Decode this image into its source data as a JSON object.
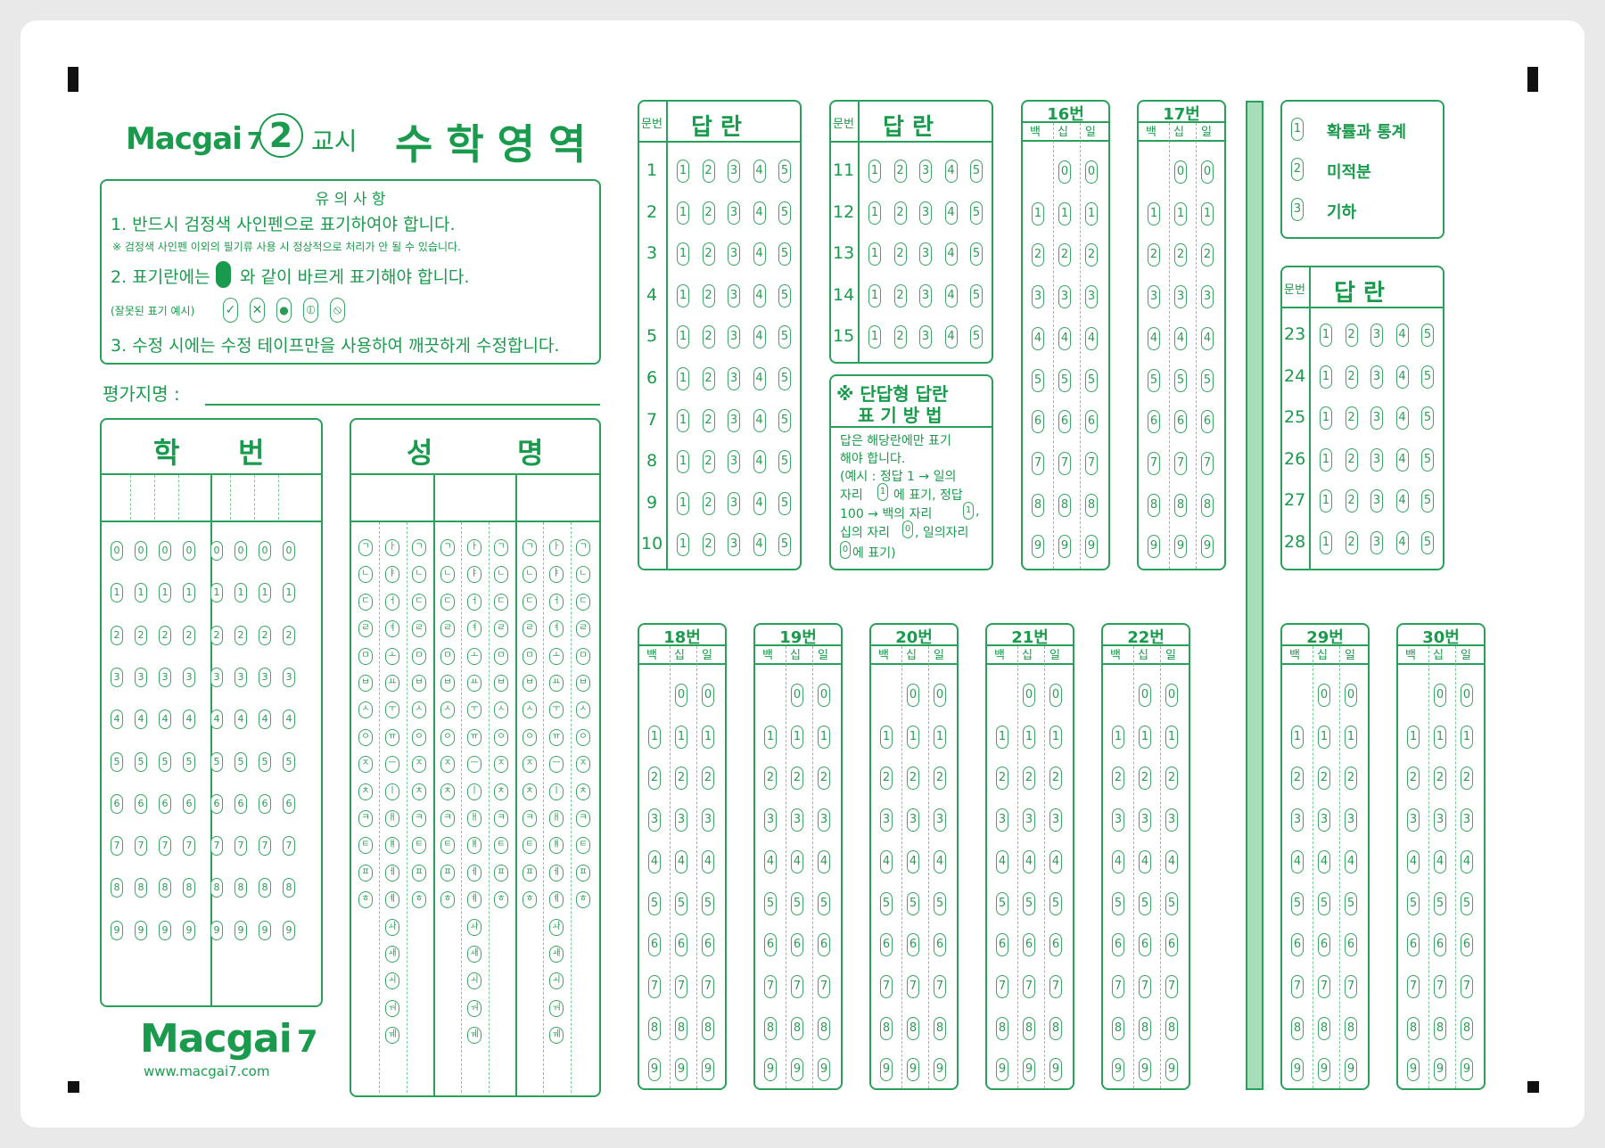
{
  "brand": {
    "logo": "Macgai",
    "logo_num": "7",
    "url": "www.macgai7.com"
  },
  "header": {
    "period_num": "2",
    "period_label": "교시",
    "subject": "수학영역"
  },
  "notice": {
    "title": "유 의 사 항",
    "line1": "1. 반드시 검정색 사인펜으로 표기하여야 합니다.",
    "line1_note": "※ 검정색 사인펜 이외의 필기류 사용 시 정상적으로 처리가 안 될 수 있습니다.",
    "line2_pre": "2. 표기란에는",
    "line2_post": "와 같이 바르게 표기해야 합니다.",
    "wrong_label": "(잘못된 표기 예시)",
    "wrong_marks": [
      "✓",
      "✕",
      "●",
      "⦶",
      "⦸"
    ],
    "line3": "3. 수정 시에는 수정 테이프만을 사용하여 깨끗하게 수정합니다."
  },
  "evaluator": {
    "label": "평가지명 :"
  },
  "student_id": {
    "title_a": "학",
    "title_b": "번",
    "digits": [
      "0",
      "1",
      "2",
      "3",
      "4",
      "5",
      "6",
      "7",
      "8",
      "9"
    ]
  },
  "name": {
    "title_a": "성",
    "title_b": "명",
    "consonants": [
      "ㄱ",
      "ㄴ",
      "ㄷ",
      "ㄹ",
      "ㅁ",
      "ㅂ",
      "ㅅ",
      "ㅇ",
      "ㅈ",
      "ㅊ",
      "ㅋ",
      "ㅌ",
      "ㅍ",
      "ㅎ"
    ],
    "vowels": [
      "ㅏ",
      "ㅑ",
      "ㅓ",
      "ㅕ",
      "ㅗ",
      "ㅛ",
      "ㅜ",
      "ㅠ",
      "ㅡ",
      "ㅣ",
      "ㅐ",
      "ㅒ",
      "ㅔ",
      "ㅖ",
      "ㅘ",
      "ㅙ",
      "ㅚ",
      "ㅝ",
      "ㅞ"
    ],
    "finals": [
      "ㄱ",
      "ㄴ",
      "ㄷ",
      "ㄹ",
      "ㅁ",
      "ㅂ",
      "ㅅ",
      "ㅇ",
      "ㅈ",
      "ㅊ",
      "ㅋ",
      "ㅌ",
      "ㅍ",
      "ㅎ"
    ]
  },
  "mc": {
    "head_num": "문번",
    "head_ans": "답   란",
    "choices": [
      "1",
      "2",
      "3",
      "4",
      "5"
    ],
    "block1": [
      "1",
      "2",
      "3",
      "4",
      "5",
      "6",
      "7",
      "8",
      "9",
      "10"
    ],
    "block2": [
      "11",
      "12",
      "13",
      "14",
      "15"
    ],
    "block3": [
      "23",
      "24",
      "25",
      "26",
      "27",
      "28"
    ]
  },
  "short_help": {
    "title1": "※ 단답형 답란",
    "title2": "표 기 방 법",
    "l1": "답은 해당란에만 표기",
    "l2": "해야 합니다.",
    "l3": "(예시 : 정답 1 → 일의",
    "l4a": "자리",
    "l4b": "에 표기, 정답",
    "l5a": "100 → 백의 자리",
    "l5b": ",",
    "l6a": "십의 자리",
    "l6b": ", 일의자리",
    "l7": "에 표기)",
    "ex1": "1",
    "ex0": "0"
  },
  "short": {
    "cols": [
      "백",
      "십",
      "일"
    ],
    "digits": [
      "0",
      "1",
      "2",
      "3",
      "4",
      "5",
      "6",
      "7",
      "8",
      "9"
    ],
    "top": [
      "16번",
      "17번"
    ],
    "bottom": [
      "18번",
      "19번",
      "20번",
      "21번",
      "22번",
      "29번",
      "30번"
    ]
  },
  "elective": {
    "options": [
      {
        "num": "1",
        "label": "확률과 통계"
      },
      {
        "num": "2",
        "label": "미적분"
      },
      {
        "num": "3",
        "label": "기하"
      }
    ]
  }
}
